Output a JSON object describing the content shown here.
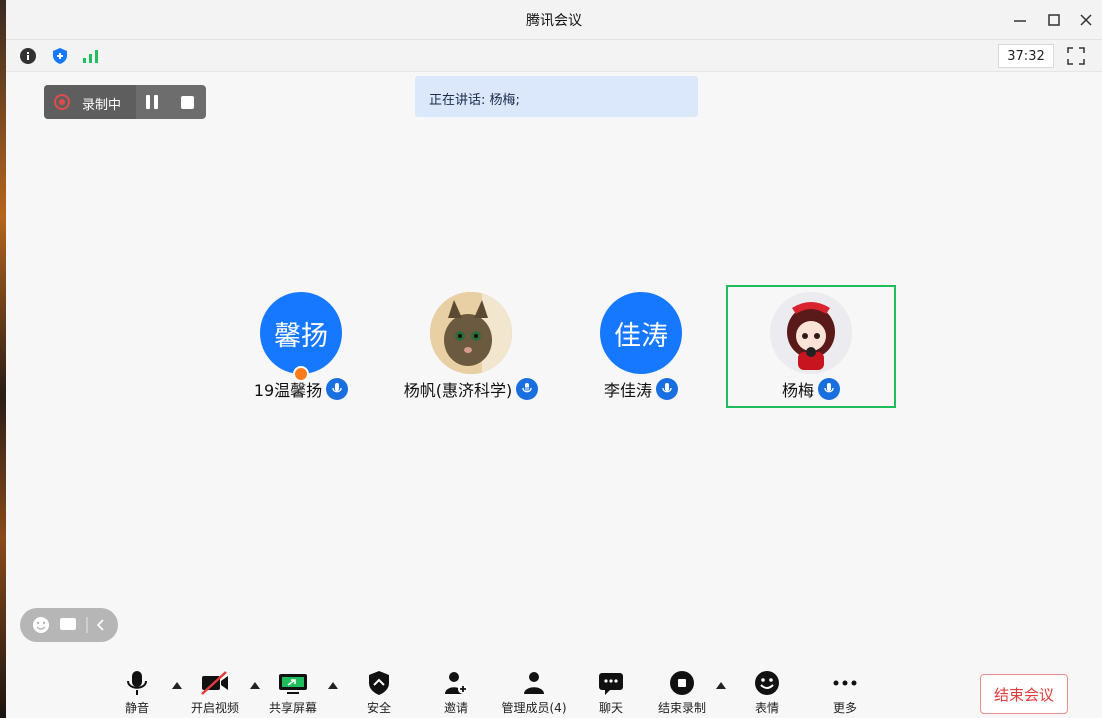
{
  "window": {
    "title": "腾讯会议"
  },
  "window_controls": [
    "minimize-icon",
    "maximize-icon",
    "close-icon"
  ],
  "infobar": {
    "icons": [
      "info-icon",
      "shield-icon",
      "signal-icon"
    ],
    "timer": "37:32"
  },
  "recording": {
    "label": "录制中"
  },
  "speaking": {
    "text": "正在讲话: 杨梅;"
  },
  "participants": [
    {
      "avatar_text": "馨扬",
      "name": "19温馨扬",
      "avatar_color": "#1677ff",
      "is_host": true
    },
    {
      "avatar_text": "",
      "name": "杨帆(惠济科学)",
      "avatar_color": "#d9b88a",
      "mic_active": true
    },
    {
      "avatar_text": "佳涛",
      "name": "李佳涛",
      "avatar_color": "#1677ff"
    },
    {
      "avatar_text": "",
      "name": "杨梅",
      "avatar_color": "#e8e8ee",
      "speaking": true
    }
  ],
  "toolbar": {
    "mute": "静音",
    "video": "开启视频",
    "share": "共享屏幕",
    "security": "安全",
    "invite": "邀请",
    "members": "管理成员(4)",
    "chat": "聊天",
    "end_record": "结束录制",
    "emoji": "表情",
    "more": "更多"
  },
  "end_meeting": "结束会议",
  "colors": {
    "accent": "#1677ff",
    "active_border": "#1fbd5b",
    "danger": "#e03c3c"
  }
}
